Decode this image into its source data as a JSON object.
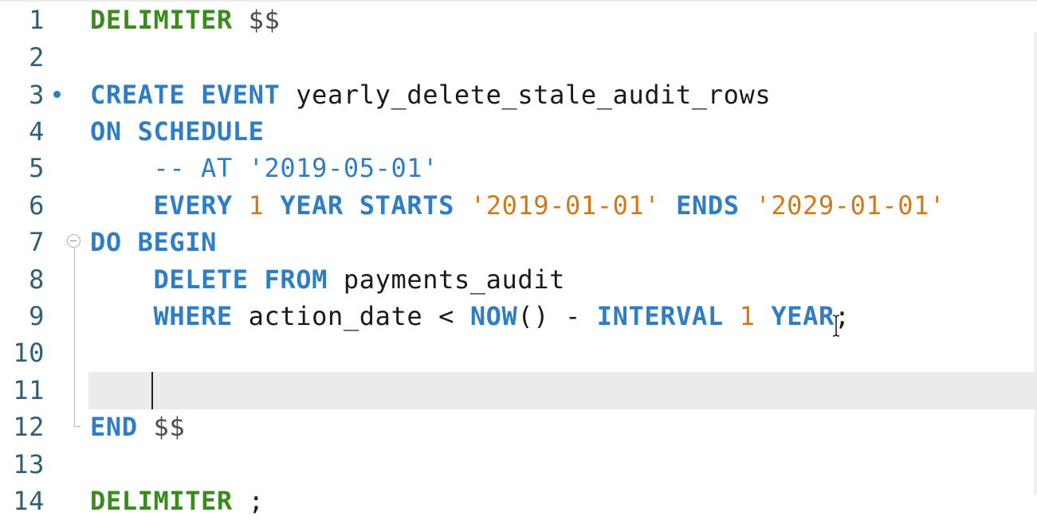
{
  "editor": {
    "current_line": "11",
    "lines": [
      {
        "n": "1",
        "tokens": [
          {
            "t": "DELIMITER",
            "c": "kw-g"
          },
          {
            "t": " ",
            "c": "plain"
          },
          {
            "t": "$$",
            "c": "dollar"
          }
        ]
      },
      {
        "n": "2",
        "tokens": []
      },
      {
        "n": "3",
        "tokens": [
          {
            "t": "CREATE",
            "c": "kw"
          },
          {
            "t": " ",
            "c": "plain"
          },
          {
            "t": "EVENT",
            "c": "kw"
          },
          {
            "t": " yearly_delete_stale_audit_rows",
            "c": "plain"
          }
        ]
      },
      {
        "n": "4",
        "tokens": [
          {
            "t": "ON",
            "c": "kw"
          },
          {
            "t": " ",
            "c": "plain"
          },
          {
            "t": "SCHEDULE",
            "c": "kw"
          }
        ]
      },
      {
        "n": "5",
        "tokens": [
          {
            "t": "    -- AT '2019-05-01'",
            "c": "cm"
          }
        ]
      },
      {
        "n": "6",
        "tokens": [
          {
            "t": "    ",
            "c": "plain"
          },
          {
            "t": "EVERY",
            "c": "kw"
          },
          {
            "t": " ",
            "c": "plain"
          },
          {
            "t": "1",
            "c": "num"
          },
          {
            "t": " ",
            "c": "plain"
          },
          {
            "t": "YEAR",
            "c": "kw"
          },
          {
            "t": " ",
            "c": "plain"
          },
          {
            "t": "STARTS",
            "c": "kw"
          },
          {
            "t": " ",
            "c": "plain"
          },
          {
            "t": "'2019-01-01'",
            "c": "str"
          },
          {
            "t": " ",
            "c": "plain"
          },
          {
            "t": "ENDS",
            "c": "kw"
          },
          {
            "t": " ",
            "c": "plain"
          },
          {
            "t": "'2029-01-01'",
            "c": "str"
          }
        ]
      },
      {
        "n": "7",
        "tokens": [
          {
            "t": "DO",
            "c": "kw"
          },
          {
            "t": " ",
            "c": "plain"
          },
          {
            "t": "BEGIN",
            "c": "kw"
          }
        ]
      },
      {
        "n": "8",
        "tokens": [
          {
            "t": "    ",
            "c": "plain"
          },
          {
            "t": "DELETE",
            "c": "kw"
          },
          {
            "t": " ",
            "c": "plain"
          },
          {
            "t": "FROM",
            "c": "kw"
          },
          {
            "t": " payments_audit",
            "c": "plain"
          }
        ]
      },
      {
        "n": "9",
        "tokens": [
          {
            "t": "    ",
            "c": "plain"
          },
          {
            "t": "WHERE",
            "c": "kw"
          },
          {
            "t": " action_date ",
            "c": "plain"
          },
          {
            "t": "<",
            "c": "op"
          },
          {
            "t": " ",
            "c": "plain"
          },
          {
            "t": "NOW",
            "c": "fn"
          },
          {
            "t": "()",
            "c": "plain"
          },
          {
            "t": " ",
            "c": "plain"
          },
          {
            "t": "-",
            "c": "op"
          },
          {
            "t": " ",
            "c": "plain"
          },
          {
            "t": "INTERVAL",
            "c": "kw"
          },
          {
            "t": " ",
            "c": "plain"
          },
          {
            "t": "1",
            "c": "num"
          },
          {
            "t": " ",
            "c": "plain"
          },
          {
            "t": "YEAR",
            "c": "kw"
          },
          {
            "t": ";",
            "c": "plain"
          }
        ]
      },
      {
        "n": "10",
        "tokens": []
      },
      {
        "n": "11",
        "tokens": []
      },
      {
        "n": "12",
        "tokens": [
          {
            "t": "END",
            "c": "kw"
          },
          {
            "t": " ",
            "c": "plain"
          },
          {
            "t": "$$",
            "c": "dollar"
          }
        ]
      },
      {
        "n": "13",
        "tokens": []
      },
      {
        "n": "14",
        "tokens": [
          {
            "t": "DELIMITER",
            "c": "kw-g"
          },
          {
            "t": " ",
            "c": "plain"
          },
          {
            "t": ";",
            "c": "plain"
          }
        ]
      }
    ]
  },
  "icons": {
    "fold_marker": "fold-collapse-icon",
    "breakpoint": "modified-line-dot-icon",
    "cursor": "text-cursor-icon"
  },
  "colors": {
    "keyword": "#2f7dc4",
    "delimiter_keyword": "#3b8a1f",
    "literal": "#cf7a18",
    "line_number": "#2f5f78",
    "current_line_bg": "#ebebeb"
  }
}
